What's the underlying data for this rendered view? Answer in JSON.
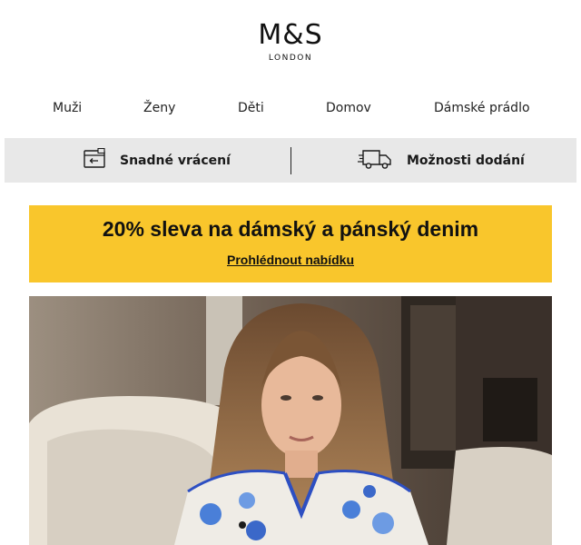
{
  "brand": {
    "name": "M&S",
    "sub": "LONDON"
  },
  "nav": {
    "items": [
      "Muži",
      "Ženy",
      "Děti",
      "Domov",
      "Dámské prádlo"
    ]
  },
  "services": {
    "returns": "Snadné vrácení",
    "delivery": "Možnosti dodání"
  },
  "promo": {
    "title": "20% sleva na dámský a pánský denim",
    "link": "Prohlédnout nabídku",
    "color": "#f9c62c"
  },
  "hero": {
    "icon": "hero-photo"
  }
}
